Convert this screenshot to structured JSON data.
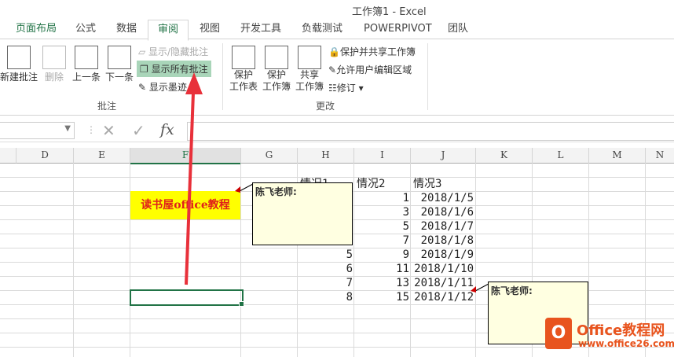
{
  "window": {
    "title": "工作簿1 - Excel"
  },
  "tabs": [
    {
      "label": "页面布局"
    },
    {
      "label": "公式"
    },
    {
      "label": "数据"
    },
    {
      "label": "审阅",
      "active": true
    },
    {
      "label": "视图"
    },
    {
      "label": "开发工具"
    },
    {
      "label": "负载测试"
    },
    {
      "label": "POWERPIVOT"
    },
    {
      "label": "团队"
    }
  ],
  "ribbon": {
    "comments_group": {
      "label": "批注",
      "new": "新建批注",
      "delete": "删除",
      "prev": "上一条",
      "next": "下一条",
      "show_hide": "显示/隐藏批注",
      "show_all": "显示所有批注",
      "show_ink": "显示墨迹"
    },
    "changes_group": {
      "label": "更改",
      "protect_sheet": [
        "保护",
        "工作表"
      ],
      "protect_book": [
        "保护",
        "工作簿"
      ],
      "share_book": [
        "共享",
        "工作簿"
      ],
      "protect_share": "保护并共享工作簿",
      "allow_edit": "允许用户编辑区域",
      "track": "修订"
    }
  },
  "formula_bar": {
    "fx": "fx",
    "value": ""
  },
  "columns": [
    "D",
    "E",
    "F",
    "G",
    "H",
    "I",
    "J",
    "K",
    "L",
    "M",
    "N"
  ],
  "cells": {
    "F_label": "读书屋office教程",
    "H_header": "情况1",
    "I_header": "情况2",
    "J_header": "情况3",
    "H": [
      "",
      "",
      "",
      "",
      "5",
      "6",
      "7",
      "8"
    ],
    "I": [
      "1",
      "3",
      "5",
      "7",
      "9",
      "11",
      "13",
      "15"
    ],
    "J": [
      "2018/1/5",
      "2018/1/6",
      "2018/1/7",
      "2018/1/8",
      "2018/1/9",
      "2018/1/10",
      "2018/1/11",
      "2018/1/12"
    ]
  },
  "comments": [
    {
      "author": "陈飞老师:"
    },
    {
      "author": "陈飞老师:"
    }
  ],
  "watermark": {
    "brand": "Office教程网",
    "url": "www.office26.com"
  },
  "colors": {
    "accent": "#217346",
    "highlight": "#a9d5b9",
    "label_bg": "#ffff00",
    "label_text": "#e0201a",
    "arrow": "#e8303a",
    "comment_bg": "#ffffe1"
  }
}
